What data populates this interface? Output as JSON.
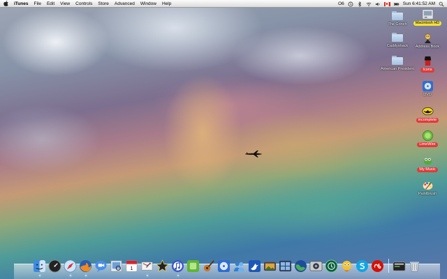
{
  "menubar": {
    "app_name": "iTunes",
    "items": [
      "File",
      "Edit",
      "View",
      "Controls",
      "Store",
      "Advanced",
      "Window",
      "Help"
    ],
    "extras_text": "O6",
    "clock": "Sun 6:41:52 AM"
  },
  "desktop": {
    "folders": [
      {
        "label": "The Grinch",
        "icon": "folder-icon"
      },
      {
        "label": "Caddyshack",
        "icon": "folder-icon"
      },
      {
        "label": "American President",
        "icon": "folder-icon"
      }
    ],
    "right_column": [
      {
        "label": "Macintosh HD",
        "icon": "hard-drive-icon",
        "tag": "yellow"
      },
      {
        "label": "Address Book",
        "icon": "address-book-icon",
        "tag": ""
      },
      {
        "label": "Icons",
        "icon": "icons-icon",
        "tag": "red"
      },
      {
        "label": "DVD",
        "icon": "dvd-icon",
        "tag": ""
      },
      {
        "label": "incomplete",
        "icon": "batman-icon",
        "tag": "red"
      },
      {
        "label": "LimeWire",
        "icon": "limewire-icon",
        "tag": "red"
      },
      {
        "label": "My Music",
        "icon": "music-icon",
        "tag": "red"
      },
      {
        "label": "Paintbrush",
        "icon": "paintbrush-icon",
        "tag": ""
      }
    ]
  },
  "dock": {
    "apps": [
      {
        "name": "finder-icon"
      },
      {
        "name": "dashboard-icon"
      },
      {
        "name": "safari-icon"
      },
      {
        "name": "firefox-icon"
      },
      {
        "name": "ichat-icon"
      },
      {
        "name": "preview-icon"
      },
      {
        "name": "ical-icon"
      },
      {
        "name": "mail-icon"
      },
      {
        "name": "imovie-icon"
      },
      {
        "name": "itunes-icon"
      },
      {
        "name": "limewire-icon"
      },
      {
        "name": "garageband-icon"
      },
      {
        "name": "dvd-player-icon"
      },
      {
        "name": "people-icon"
      },
      {
        "name": "bird-icon"
      },
      {
        "name": "iphoto-icon"
      },
      {
        "name": "spaces-icon"
      },
      {
        "name": "google-earth-icon"
      },
      {
        "name": "photo-booth-icon"
      },
      {
        "name": "time-machine-icon"
      },
      {
        "name": "adium-icon"
      },
      {
        "name": "skype-icon"
      },
      {
        "name": "lastfm-icon"
      }
    ],
    "right": [
      {
        "name": "terminal-stack-icon"
      },
      {
        "name": "trash-icon"
      }
    ],
    "ical_day": "1"
  },
  "colors": {
    "menubar": "#e6e6e6",
    "tag_yellow": "#f3e13a",
    "tag_red": "#e03a3a"
  }
}
